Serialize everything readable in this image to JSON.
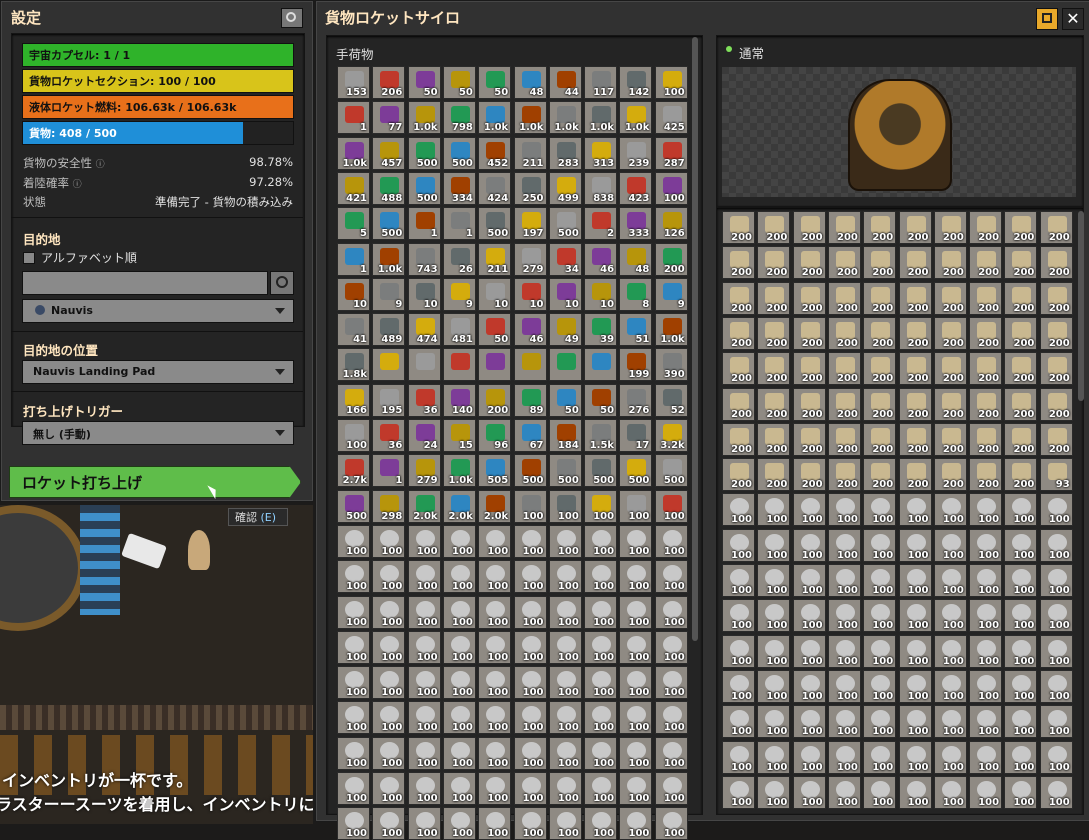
{
  "left_panel": {
    "title": "設定",
    "bars": [
      {
        "label": "宇宙カプセル: 1 / 1",
        "fraction": 1.0,
        "color": "#2fb32a"
      },
      {
        "label": "貨物ロケットセクション: 100 / 100",
        "fraction": 1.0,
        "color": "#d8c41a"
      },
      {
        "label": "液体ロケット燃料: 106.63k / 106.63k",
        "fraction": 1.0,
        "color": "#e8701a"
      },
      {
        "label": "貨物: 408 / 500",
        "fraction": 0.816,
        "color": "#1f8fd8"
      }
    ],
    "stats": [
      {
        "label": "貨物の安全性",
        "value": "98.78%"
      },
      {
        "label": "着陸確率",
        "value": "97.28%"
      },
      {
        "label": "状態",
        "value": "準備完了 - 貨物の積み込み"
      }
    ],
    "destination_header": "目的地",
    "alphabetical_label": "アルファベット順",
    "planet_value": "Nauvis",
    "location_header": "目的地の位置",
    "location_value": "Nauvis Landing Pad",
    "trigger_header": "打ち上げトリガー",
    "trigger_value": "無し (手動)",
    "launch_label": "ロケット打ち上げ",
    "confirm_label": "確認",
    "confirm_key": "(E)",
    "message_1": "インベントリが一杯です。",
    "message_2": "ラスターースーツを着用し、インベントリに"
  },
  "main_window": {
    "title": "貨物ロケットサイロ",
    "inventory_title": "手荷物",
    "status_label": "通常",
    "inventory_counts": [
      "153",
      "206",
      "50",
      "50",
      "50",
      "48",
      "44",
      "117",
      "142",
      "100",
      "1",
      "77",
      "1.0k",
      "798",
      "1.0k",
      "1.0k",
      "1.0k",
      "1.0k",
      "1.0k",
      "425",
      "1.0k",
      "457",
      "500",
      "500",
      "452",
      "211",
      "283",
      "313",
      "239",
      "287",
      "421",
      "488",
      "500",
      "334",
      "424",
      "250",
      "499",
      "838",
      "423",
      "100",
      "5",
      "500",
      "1",
      "1",
      "500",
      "197",
      "500",
      "2",
      "333",
      "126",
      "1",
      "1.0k",
      "743",
      "26",
      "211",
      "279",
      "34",
      "46",
      "48",
      "200",
      "10",
      "9",
      "10",
      "9",
      "10",
      "10",
      "10",
      "10",
      "8",
      "9",
      "41",
      "489",
      "474",
      "481",
      "50",
      "46",
      "49",
      "39",
      "51",
      "1.0k",
      "1.8k",
      "",
      "",
      "",
      "",
      "",
      "",
      "",
      "199",
      "390",
      "166",
      "195",
      "36",
      "140",
      "200",
      "89",
      "50",
      "50",
      "276",
      "52",
      "100",
      "36",
      "24",
      "15",
      "96",
      "67",
      "184",
      "1.5k",
      "17",
      "3.2k",
      "2.7k",
      "1",
      "279",
      "1.0k",
      "505",
      "500",
      "500",
      "500",
      "500",
      "500",
      "500",
      "298",
      "2.0k",
      "2.0k",
      "2.0k",
      "100",
      "100",
      "100",
      "100",
      "100"
    ],
    "inventory_filler_count": "100",
    "inventory_filler_rows": 9,
    "silo_counts_row_last": [
      "200",
      "200",
      "200",
      "200",
      "200",
      "200",
      "200",
      "200",
      "200",
      "93"
    ],
    "silo_bricks_count": "200",
    "silo_bricks_rows": 7,
    "silo_filler_count": "100",
    "silo_filler_rows": 9
  }
}
